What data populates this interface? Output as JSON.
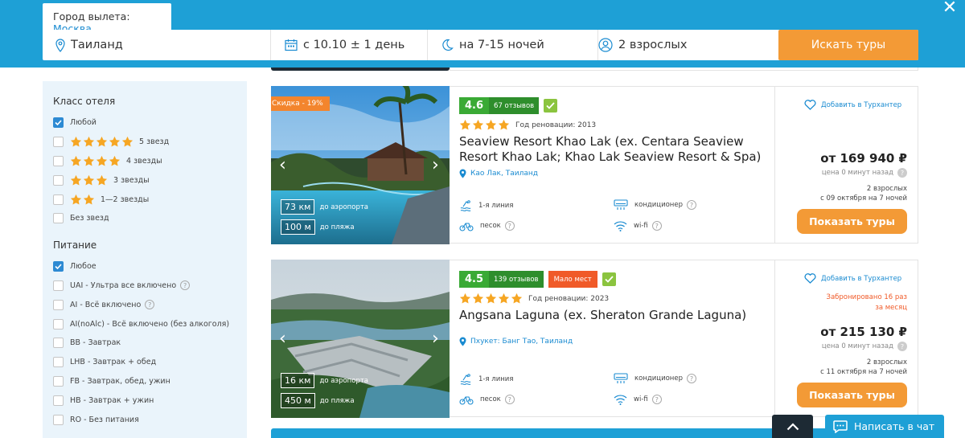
{
  "search": {
    "city_label": "Город вылета:",
    "city_value": "Москва",
    "destination": "Таиланд",
    "date": "с 10.10 ± 1 день",
    "nights": "на 7-15 ночей",
    "guests": "2 взрослых",
    "search_button": "Искать туры"
  },
  "filters": {
    "hotel_class_title": "Класс отеля",
    "hotel_class": [
      {
        "label": "Любой",
        "checked": true,
        "stars": 0
      },
      {
        "label": "5 звезд",
        "checked": false,
        "stars": 5
      },
      {
        "label": "4 звезды",
        "checked": false,
        "stars": 4
      },
      {
        "label": "3 звезды",
        "checked": false,
        "stars": 3
      },
      {
        "label": "1—2 звезды",
        "checked": false,
        "stars": 2
      },
      {
        "label": "Без звезд",
        "checked": false,
        "stars": 0
      }
    ],
    "meal_title": "Питание",
    "meal": [
      {
        "label": "Любое",
        "checked": true,
        "help": false
      },
      {
        "label": "UAI - Ультра все включено",
        "checked": false,
        "help": true
      },
      {
        "label": "AI - Всё включено",
        "checked": false,
        "help": true
      },
      {
        "label": "AI(noAlc) - Всё включено (без алкоголя)",
        "checked": false,
        "help": false
      },
      {
        "label": "BB - Завтрак",
        "checked": false,
        "help": false
      },
      {
        "label": "LHB - Завтрак + обед",
        "checked": false,
        "help": false
      },
      {
        "label": "FB - Завтрак, обед, ужин",
        "checked": false,
        "help": false
      },
      {
        "label": "HB - Завтрак + ужин",
        "checked": false,
        "help": false
      },
      {
        "label": "RO - Без питания",
        "checked": false,
        "help": false
      }
    ]
  },
  "hotels": [
    {
      "discount": "Скидка - 19%",
      "airport_km": "73 км",
      "airport_label": "до аэропорта",
      "beach_m": "100 м",
      "beach_label": "до пляжа",
      "rating": "4.6",
      "reviews": "67 отзывов",
      "low_seats": "",
      "stars": 4,
      "renovation": "Год реновации: 2013",
      "name": "Seaview Resort Khao Lak (ex. Centara Seaview Resort Khao Lak; Khao Lak Seaview Resort & Spa)",
      "location": "Као Лак, Таиланд",
      "amenity_line": "1-я линия",
      "amenity_ac": "кондиционер",
      "amenity_sand": "песок",
      "amenity_wifi": "wi-fi",
      "favorite": "Добавить в Турхантер",
      "booked": "",
      "price": "от 169 940 ₽",
      "price_note": "цена 0 минут назад",
      "guests": "2 взрослых",
      "dates": "с 09 октября на 7 ночей",
      "show_button": "Показать туры"
    },
    {
      "discount": "",
      "airport_km": "16 км",
      "airport_label": "до аэропорта",
      "beach_m": "450 м",
      "beach_label": "до пляжа",
      "rating": "4.5",
      "reviews": "139 отзывов",
      "low_seats": "Мало мест",
      "stars": 5,
      "renovation": "Год реновации: 2023",
      "name": "Angsana Laguna (ex. Sheraton Grande Laguna)",
      "location": "Пхукет: Банг Тао, Таиланд",
      "amenity_line": "1-я линия",
      "amenity_ac": "кондиционер",
      "amenity_sand": "песок",
      "amenity_wifi": "wi-fi",
      "favorite": "Добавить в Турхантер",
      "booked_line1": "Забронировано 16 раз",
      "booked_line2": "за месяц",
      "price": "от 215 130 ₽",
      "price_note": "цена 0 минут назад",
      "guests": "2 взрослых",
      "dates": "с 11 октября на 7 ночей",
      "show_button": "Показать туры"
    }
  ],
  "chat": {
    "label": "Написать в чат"
  },
  "colors": {
    "brand_blue": "#1ea0d6",
    "orange": "#f39a36",
    "rating_green": "#3aaa35",
    "alert_red": "#f05a28"
  }
}
